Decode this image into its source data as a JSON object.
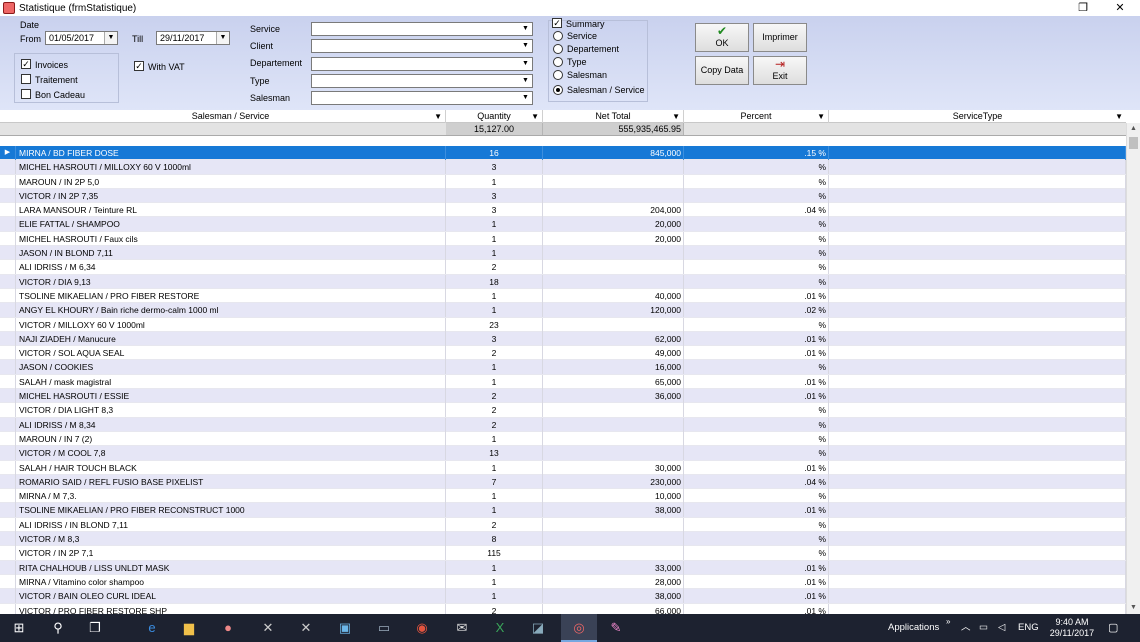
{
  "window": {
    "title": "Statistique  (frmStatistique)",
    "restore_glyph": "❐",
    "close_glyph": "✕"
  },
  "filters": {
    "date_group_label": "Date",
    "from_label": "From",
    "from_value": "01/05/2017",
    "till_label": "Till",
    "till_value": "29/11/2017",
    "invoices_label": "Invoices",
    "invoices_checked": true,
    "traitement_label": "Traitement",
    "traitement_checked": false,
    "bon_cadeau_label": "Bon Cadeau",
    "bon_cadeau_checked": false,
    "with_vat_label": "With VAT",
    "with_vat_checked": true,
    "service_label": "Service",
    "client_label": "Client",
    "departement_label": "Departement",
    "type_label": "Type",
    "salesman_label": "Salesman"
  },
  "grouping": {
    "summary_label": "Summary",
    "summary_checked": true,
    "options": [
      "Service",
      "Departement",
      "Type",
      "Salesman",
      "Salesman / Service"
    ],
    "selected": "Salesman / Service"
  },
  "buttons": {
    "ok": "OK",
    "imprimer": "Imprimer",
    "copy_data": "Copy Data",
    "exit": "Exit"
  },
  "grid": {
    "columns": [
      "Salesman / Service",
      "Quantity",
      "Net Total",
      "Percent",
      "ServiceType"
    ],
    "totals": {
      "quantity": "15,127.00",
      "net_total": "555,935,465.95"
    },
    "rows": [
      {
        "name": "MIRNA / BD FIBER DOSE",
        "qty": "16",
        "net": "845,000",
        "pct": ".15 %"
      },
      {
        "name": "MICHEL HASROUTI / MILLOXY 60 V 1000ml",
        "qty": "3",
        "net": "",
        "pct": "%"
      },
      {
        "name": "MAROUN / IN 2P 5,0",
        "qty": "1",
        "net": "",
        "pct": "%"
      },
      {
        "name": "VICTOR / IN 2P 7,35",
        "qty": "3",
        "net": "",
        "pct": "%"
      },
      {
        "name": "LARA MANSOUR / Teinture RL",
        "qty": "3",
        "net": "204,000",
        "pct": ".04 %"
      },
      {
        "name": "ELIE FATTAL / SHAMPOO",
        "qty": "1",
        "net": "20,000",
        "pct": "%"
      },
      {
        "name": "MICHEL HASROUTI / Faux cils",
        "qty": "1",
        "net": "20,000",
        "pct": "%"
      },
      {
        "name": "JASON / IN BLOND 7,11",
        "qty": "1",
        "net": "",
        "pct": "%"
      },
      {
        "name": "ALI IDRISS / M 6,34",
        "qty": "2",
        "net": "",
        "pct": "%"
      },
      {
        "name": "VICTOR / DIA 9,13",
        "qty": "18",
        "net": "",
        "pct": "%"
      },
      {
        "name": "TSOLINE MIKAELIAN / PRO FIBER RESTORE",
        "qty": "1",
        "net": "40,000",
        "pct": ".01 %"
      },
      {
        "name": "ANGY EL KHOURY / Bain riche dermo-calm 1000 ml",
        "qty": "1",
        "net": "120,000",
        "pct": ".02 %"
      },
      {
        "name": "VICTOR / MILLOXY 60 V 1000ml",
        "qty": "23",
        "net": "",
        "pct": "%"
      },
      {
        "name": "NAJI ZIADEH / Manucure",
        "qty": "3",
        "net": "62,000",
        "pct": ".01 %"
      },
      {
        "name": "VICTOR / SOL AQUA SEAL",
        "qty": "2",
        "net": "49,000",
        "pct": ".01 %"
      },
      {
        "name": "JASON / COOKIES",
        "qty": "1",
        "net": "16,000",
        "pct": "%"
      },
      {
        "name": "SALAH / mask magistral",
        "qty": "1",
        "net": "65,000",
        "pct": ".01 %"
      },
      {
        "name": "MICHEL HASROUTI / ESSIE",
        "qty": "2",
        "net": "36,000",
        "pct": ".01 %"
      },
      {
        "name": "VICTOR / DIA LIGHT 8,3",
        "qty": "2",
        "net": "",
        "pct": "%"
      },
      {
        "name": "ALI IDRISS / M 8,34",
        "qty": "2",
        "net": "",
        "pct": "%"
      },
      {
        "name": "MAROUN / IN 7 (2)",
        "qty": "1",
        "net": "",
        "pct": "%"
      },
      {
        "name": "VICTOR / M COOL 7,8",
        "qty": "13",
        "net": "",
        "pct": "%"
      },
      {
        "name": "SALAH / HAIR TOUCH BLACK",
        "qty": "1",
        "net": "30,000",
        "pct": ".01 %"
      },
      {
        "name": "ROMARIO SAID / REFL FUSIO BASE PIXELIST",
        "qty": "7",
        "net": "230,000",
        "pct": ".04 %"
      },
      {
        "name": "MIRNA / M 7,3.",
        "qty": "1",
        "net": "10,000",
        "pct": "%"
      },
      {
        "name": "TSOLINE MIKAELIAN / PRO FIBER RECONSTRUCT 1000",
        "qty": "1",
        "net": "38,000",
        "pct": ".01 %"
      },
      {
        "name": "ALI IDRISS / IN BLOND 7,11",
        "qty": "2",
        "net": "",
        "pct": "%"
      },
      {
        "name": "VICTOR / M 8,3",
        "qty": "8",
        "net": "",
        "pct": "%"
      },
      {
        "name": "VICTOR / IN 2P 7,1",
        "qty": "115",
        "net": "",
        "pct": "%"
      },
      {
        "name": "RITA CHALHOUB / LISS UNLDT MASK",
        "qty": "1",
        "net": "33,000",
        "pct": ".01 %"
      },
      {
        "name": "MIRNA / Vitamino color shampoo",
        "qty": "1",
        "net": "28,000",
        "pct": ".01 %"
      },
      {
        "name": "VICTOR / BAIN OLEO CURL IDEAL",
        "qty": "1",
        "net": "38,000",
        "pct": ".01 %"
      },
      {
        "name": "VICTOR / PRO FIBER RESTORE SHP",
        "qty": "2",
        "net": "66,000",
        "pct": ".01 %"
      }
    ]
  },
  "taskbar": {
    "applications_label": "Applications",
    "language": "ENG",
    "time": "9:40 AM",
    "date": "29/11/2017"
  },
  "colors": {
    "panel": "#d4dbf3",
    "selected_row": "#1679d6",
    "alt_row": "#e6e6f6",
    "taskbar": "#1d2230"
  }
}
